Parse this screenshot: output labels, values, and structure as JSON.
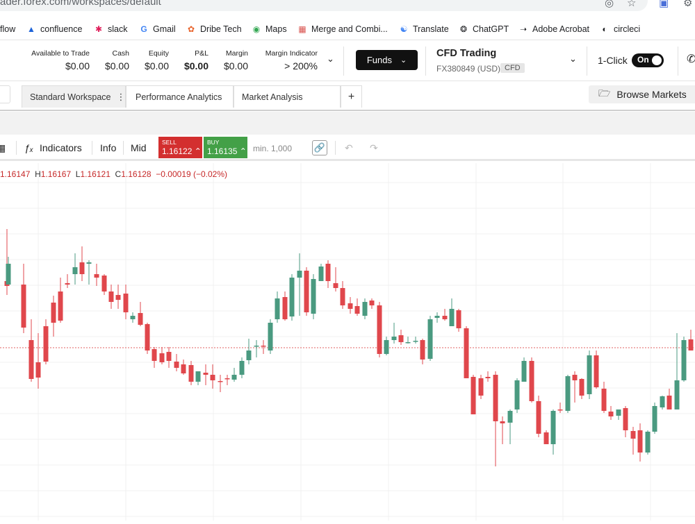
{
  "browser": {
    "url": "ader.forex.com/workspaces/default",
    "bookmarks": [
      {
        "label": "flow",
        "icon": "none"
      },
      {
        "label": "confluence",
        "icon": "confluence-icon"
      },
      {
        "label": "slack",
        "icon": "slack-icon"
      },
      {
        "label": "Gmail",
        "icon": "google-icon"
      },
      {
        "label": "Dribe Tech",
        "icon": "dribe-icon"
      },
      {
        "label": "Maps",
        "icon": "maps-icon"
      },
      {
        "label": "Merge and Combi...",
        "icon": "merge-icon"
      },
      {
        "label": "Translate",
        "icon": "translate-icon"
      },
      {
        "label": "ChatGPT",
        "icon": "chatgpt-icon"
      },
      {
        "label": "Adobe Acrobat",
        "icon": "acrobat-icon"
      },
      {
        "label": "circleci",
        "icon": "circleci-icon"
      }
    ]
  },
  "account": {
    "metrics": [
      {
        "label": "Available to Trade",
        "value": "$0.00",
        "bold": false
      },
      {
        "label": "Cash",
        "value": "$0.00",
        "bold": false
      },
      {
        "label": "Equity",
        "value": "$0.00",
        "bold": false
      },
      {
        "label": "P&L",
        "value": "$0.00",
        "bold": true
      },
      {
        "label": "Margin",
        "value": "$0.00",
        "bold": false
      },
      {
        "label": "Margin Indicator",
        "value": "> 200%",
        "bold": false
      }
    ],
    "funds_label": "Funds",
    "account_type": "CFD Trading",
    "account_id": "FX380849 (USD)",
    "account_badge": "CFD",
    "one_click_label": "1-Click",
    "one_click_state": "On"
  },
  "tabs": {
    "items": [
      "Standard Workspace",
      "Performance Analytics",
      "Market Analysis"
    ],
    "active": 0,
    "add_label": "+",
    "browse_label": "Browse Markets"
  },
  "toolbar": {
    "indicators_label": "Indicators",
    "info_label": "Info",
    "mid_label": "Mid",
    "sell": {
      "label": "SELL",
      "price": "1.16122"
    },
    "buy": {
      "label": "BUY",
      "price": "1.16135"
    },
    "min_qty": "min. 1,000"
  },
  "ohlc": {
    "open": "1.16147",
    "high_label": "H",
    "high": "1.16167",
    "low_label": "L",
    "low": "1.16121",
    "close_label": "C",
    "close": "1.16128",
    "change": "−0.00019 (−0.02%)"
  },
  "colors": {
    "up": "#4a9a80",
    "down": "#e0474c",
    "sell": "#d32f2f",
    "buy": "#43a047"
  },
  "chart_data": {
    "type": "candlestick",
    "title": "",
    "current_price_line": 501,
    "candles": [
      [
        -99,
        375,
        372,
        505,
        470
      ],
      [
        10,
        405,
        330,
        425,
        412
      ],
      [
        12,
        410,
        370,
        410,
        380
      ],
      [
        34,
        410,
        380,
        480,
        472
      ],
      [
        45,
        490,
        460,
        550,
        546
      ],
      [
        55,
        522,
        480,
        560,
        544
      ],
      [
        66,
        470,
        460,
        525,
        521
      ],
      [
        77,
        436,
        426,
        485,
        465
      ],
      [
        87,
        420,
        400,
        465,
        462
      ],
      [
        97,
        408,
        395,
        415,
        410
      ],
      [
        108,
        395,
        365,
        410,
        385
      ],
      [
        118,
        378,
        355,
        405,
        395
      ],
      [
        128,
        380,
        375,
        410,
        378
      ],
      [
        139,
        395,
        380,
        412,
        400
      ],
      [
        150,
        397,
        395,
        425,
        420
      ],
      [
        160,
        420,
        410,
        445,
        435
      ],
      [
        170,
        425,
        410,
        445,
        432
      ],
      [
        181,
        423,
        410,
        460,
        450
      ],
      [
        191,
        460,
        450,
        465,
        455
      ],
      [
        202,
        451,
        435,
        470,
        468
      ],
      [
        212,
        467,
        465,
        510,
        505
      ],
      [
        222,
        503,
        500,
        530,
        520
      ],
      [
        233,
        509,
        500,
        525,
        522
      ],
      [
        243,
        507,
        500,
        530,
        520
      ],
      [
        254,
        521,
        510,
        535,
        530
      ],
      [
        264,
        525,
        518,
        540,
        538
      ],
      [
        275,
        526,
        520,
        555,
        550
      ],
      [
        285,
        550,
        535,
        555,
        535
      ],
      [
        296,
        537,
        525,
        555,
        540
      ],
      [
        306,
        540,
        525,
        560,
        548
      ],
      [
        317,
        549,
        540,
        565,
        550
      ],
      [
        327,
        545,
        540,
        555,
        545
      ],
      [
        337,
        547,
        530,
        550,
        540
      ],
      [
        348,
        540,
        515,
        545,
        520
      ],
      [
        358,
        519,
        488,
        525,
        505
      ],
      [
        369,
        499,
        490,
        515,
        498
      ],
      [
        379,
        498,
        490,
        510,
        499
      ],
      [
        389,
        505,
        460,
        510,
        465
      ],
      [
        399,
        460,
        420,
        465,
        430
      ],
      [
        410,
        428,
        420,
        462,
        460
      ],
      [
        420,
        456,
        395,
        462,
        400
      ],
      [
        431,
        400,
        365,
        455,
        390
      ],
      [
        441,
        390,
        385,
        455,
        450
      ],
      [
        451,
        452,
        395,
        460,
        402
      ],
      [
        462,
        405,
        380,
        405,
        384
      ],
      [
        472,
        380,
        375,
        415,
        405
      ],
      [
        483,
        408,
        385,
        420,
        415
      ],
      [
        493,
        415,
        405,
        445,
        440
      ],
      [
        504,
        437,
        428,
        452,
        445
      ],
      [
        514,
        441,
        430,
        455,
        452
      ],
      [
        525,
        455,
        430,
        460,
        435
      ],
      [
        535,
        433,
        430,
        445,
        440
      ],
      [
        546,
        440,
        435,
        515,
        510
      ],
      [
        556,
        510,
        485,
        512,
        490
      ],
      [
        567,
        490,
        465,
        495,
        485
      ],
      [
        577,
        483,
        475,
        497,
        493
      ],
      [
        587,
        494,
        485,
        495,
        493
      ],
      [
        598,
        492,
        485,
        495,
        491
      ],
      [
        608,
        490,
        488,
        525,
        518
      ],
      [
        619,
        517,
        455,
        520,
        460
      ],
      [
        629,
        458,
        450,
        465,
        455
      ],
      [
        640,
        455,
        445,
        462,
        460
      ],
      [
        650,
        470,
        430,
        470,
        445
      ],
      [
        660,
        447,
        445,
        478,
        473
      ],
      [
        671,
        473,
        470,
        545,
        545
      ],
      [
        681,
        543,
        540,
        595,
        597
      ],
      [
        692,
        545,
        540,
        575,
        570
      ],
      [
        702,
        543,
        535,
        550,
        545
      ],
      [
        713,
        540,
        535,
        672,
        607
      ],
      [
        723,
        607,
        600,
        640,
        610
      ],
      [
        734,
        609,
        590,
        640,
        592
      ],
      [
        744,
        590,
        545,
        595,
        548
      ],
      [
        754,
        550,
        515,
        550,
        520
      ],
      [
        765,
        520,
        515,
        580,
        578
      ],
      [
        775,
        578,
        570,
        630,
        625
      ],
      [
        786,
        623,
        620,
        640,
        640
      ],
      [
        796,
        640,
        590,
        655,
        592
      ],
      [
        806,
        590,
        580,
        595,
        590
      ],
      [
        817,
        592,
        540,
        595,
        542
      ],
      [
        827,
        540,
        535,
        580,
        548
      ],
      [
        837,
        546,
        545,
        575,
        570
      ],
      [
        848,
        568,
        505,
        575,
        512
      ],
      [
        858,
        512,
        505,
        560,
        558
      ],
      [
        869,
        560,
        550,
        595,
        592
      ],
      [
        879,
        593,
        585,
        605,
        600
      ],
      [
        890,
        599,
        595,
        605,
        590
      ],
      [
        900,
        588,
        585,
        630,
        620
      ],
      [
        911,
        621,
        615,
        655,
        632
      ],
      [
        921,
        620,
        610,
        665,
        652
      ],
      [
        932,
        652,
        620,
        655,
        622
      ],
      [
        942,
        622,
        580,
        625,
        585
      ],
      [
        953,
        587,
        570,
        590,
        571
      ],
      [
        963,
        570,
        560,
        590,
        590
      ],
      [
        974,
        590,
        480,
        590,
        548
      ],
      [
        984,
        548,
        485,
        550,
        490
      ],
      [
        994,
        489,
        475,
        505,
        505
      ]
    ]
  }
}
